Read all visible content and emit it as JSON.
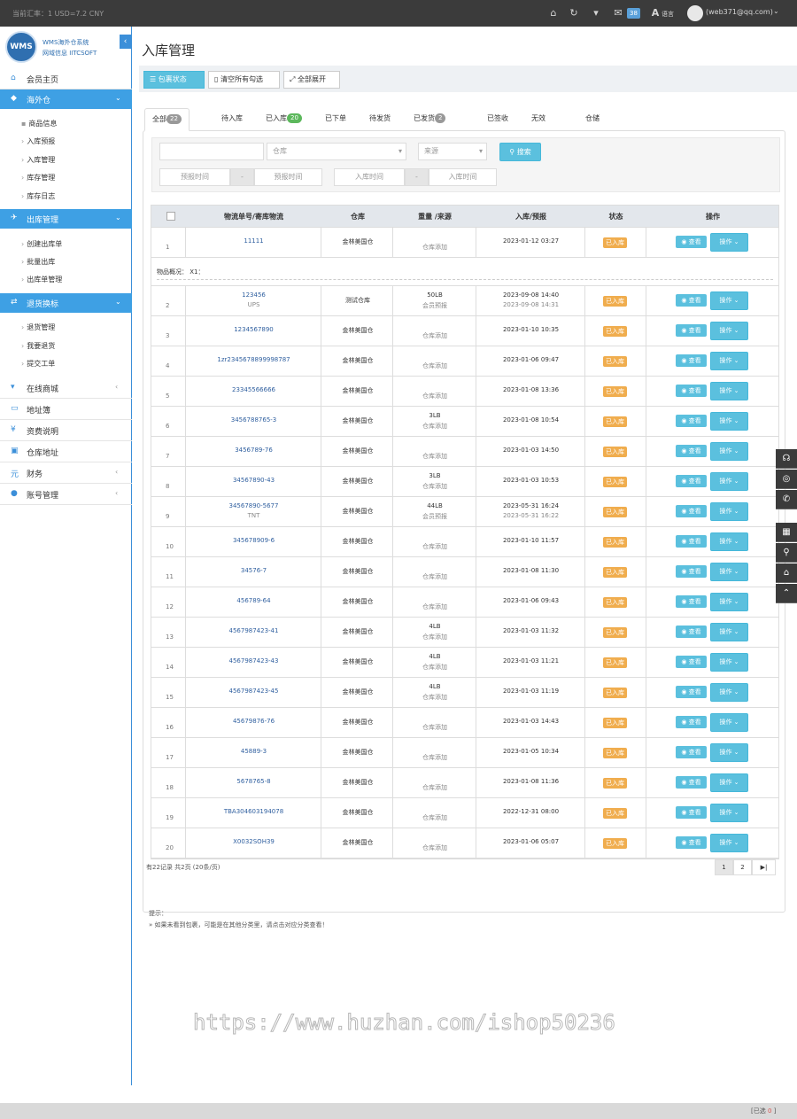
{
  "topbar": {
    "rate": "当前汇率：1 USD=7.2 CNY",
    "icons": [
      "home-icon",
      "refresh-icon",
      "cart-icon",
      "mail-icon"
    ],
    "mail_count": "38",
    "lang": "语言",
    "user": "(web371@qq.com)"
  },
  "brand": {
    "logo": "WMS",
    "line1": "WMS海外仓系统",
    "line2": "网域信息 IITCSOFT"
  },
  "sidebar": {
    "member_home": "会员主页",
    "sec_overseas": "海外仓",
    "overseas_items": [
      "商品信息",
      "入库预报",
      "入库管理",
      "库存管理",
      "库存日志"
    ],
    "sec_outbound": "出库管理",
    "outbound_items": [
      "创建出库单",
      "批量出库",
      "出库单管理"
    ],
    "sec_returns": "退货换标",
    "returns_items": [
      "退货管理",
      "我要退货",
      "提交工单"
    ],
    "online_mall": "在线商城",
    "address_book": "地址簿",
    "fee_desc": "资费说明",
    "warehouse_addr": "仓库地址",
    "finance": "财务",
    "account": "账号管理"
  },
  "page": {
    "title": "入库管理",
    "btn_status": "包裹状态",
    "btn_clear": "清空所有勾选",
    "btn_expand": "全部展开"
  },
  "tabs": {
    "all": "全部",
    "all_count": "22",
    "pending_in": "待入库",
    "in_stock": "已入库",
    "in_stock_count": "20",
    "ordered": "已下单",
    "pending_ship": "待发货",
    "shipped": "已发货",
    "shipped_count": "2",
    "signed": "已签收",
    "invalid": "无效",
    "storage": "仓储"
  },
  "filter": {
    "warehouse_placeholder": "仓库",
    "source_placeholder": "来源",
    "search": "搜索",
    "forecast_from": "预报时间",
    "forecast_to": "预报时间",
    "in_from": "入库时间",
    "in_to": "入库时间",
    "sep": "-"
  },
  "table": {
    "headers": [
      "物流单号/寄库物流",
      "仓库",
      "重量 /来源",
      "入库/预报",
      "状态",
      "操作"
    ],
    "goods_label": "物品概况：  X1：",
    "status_label": "已入库",
    "view_label": "查看",
    "op_label": "操作",
    "rows": [
      {
        "no": "1",
        "trk": "11111",
        "trk2": "",
        "wh": "金林美国仓",
        "w": "",
        "src": "仓库添加",
        "d1": "2023-01-12 03:27",
        "d2": ""
      },
      {
        "no": "2",
        "trk": "123456",
        "trk2": "UPS",
        "wh": "测试仓库",
        "w": "50LB",
        "src": "会员预报",
        "d1": "2023-09-08 14:40",
        "d2": "2023-09-08 14:31"
      },
      {
        "no": "3",
        "trk": "1234567890",
        "trk2": "",
        "wh": "金林美国仓",
        "w": "",
        "src": "仓库添加",
        "d1": "2023-01-10 10:35",
        "d2": ""
      },
      {
        "no": "4",
        "trk": "1zr2345678899998787",
        "trk2": "",
        "wh": "金林美国仓",
        "w": "",
        "src": "仓库添加",
        "d1": "2023-01-06 09:47",
        "d2": ""
      },
      {
        "no": "5",
        "trk": "23345566666",
        "trk2": "",
        "wh": "金林美国仓",
        "w": "",
        "src": "仓库添加",
        "d1": "2023-01-08 13:36",
        "d2": ""
      },
      {
        "no": "6",
        "trk": "3456788765-3",
        "trk2": "",
        "wh": "金林美国仓",
        "w": "3LB",
        "src": "仓库添加",
        "d1": "2023-01-08 10:54",
        "d2": ""
      },
      {
        "no": "7",
        "trk": "3456789-76",
        "trk2": "",
        "wh": "金林美国仓",
        "w": "",
        "src": "仓库添加",
        "d1": "2023-01-03 14:50",
        "d2": ""
      },
      {
        "no": "8",
        "trk": "34567890-43",
        "trk2": "",
        "wh": "金林美国仓",
        "w": "3LB",
        "src": "仓库添加",
        "d1": "2023-01-03 10:53",
        "d2": ""
      },
      {
        "no": "9",
        "trk": "34567890-5677",
        "trk2": "TNT",
        "wh": "金林美国仓",
        "w": "44LB",
        "src": "会员预报",
        "d1": "2023-05-31 16:24",
        "d2": "2023-05-31 16:22"
      },
      {
        "no": "10",
        "trk": "345678909-6",
        "trk2": "",
        "wh": "金林美国仓",
        "w": "",
        "src": "仓库添加",
        "d1": "2023-01-10 11:57",
        "d2": ""
      },
      {
        "no": "11",
        "trk": "34576-7",
        "trk2": "",
        "wh": "金林美国仓",
        "w": "",
        "src": "仓库添加",
        "d1": "2023-01-08 11:30",
        "d2": ""
      },
      {
        "no": "12",
        "trk": "456789-64",
        "trk2": "",
        "wh": "金林美国仓",
        "w": "",
        "src": "仓库添加",
        "d1": "2023-01-06 09:43",
        "d2": ""
      },
      {
        "no": "13",
        "trk": "4567987423-41",
        "trk2": "",
        "wh": "金林美国仓",
        "w": "4LB",
        "src": "仓库添加",
        "d1": "2023-01-03 11:32",
        "d2": ""
      },
      {
        "no": "14",
        "trk": "4567987423-43",
        "trk2": "",
        "wh": "金林美国仓",
        "w": "4LB",
        "src": "仓库添加",
        "d1": "2023-01-03 11:21",
        "d2": ""
      },
      {
        "no": "15",
        "trk": "4567987423-45",
        "trk2": "",
        "wh": "金林美国仓",
        "w": "4LB",
        "src": "仓库添加",
        "d1": "2023-01-03 11:19",
        "d2": ""
      },
      {
        "no": "16",
        "trk": "45679876-76",
        "trk2": "",
        "wh": "金林美国仓",
        "w": "",
        "src": "仓库添加",
        "d1": "2023-01-03 14:43",
        "d2": ""
      },
      {
        "no": "17",
        "trk": "45889-3",
        "trk2": "",
        "wh": "金林美国仓",
        "w": "",
        "src": "仓库添加",
        "d1": "2023-01-05 10:34",
        "d2": ""
      },
      {
        "no": "18",
        "trk": "5678765-8",
        "trk2": "",
        "wh": "金林美国仓",
        "w": "",
        "src": "仓库添加",
        "d1": "2023-01-08 11:36",
        "d2": ""
      },
      {
        "no": "19",
        "trk": "TBA304603194078",
        "trk2": "",
        "wh": "金林美国仓",
        "w": "",
        "src": "仓库添加",
        "d1": "2022-12-31 08:00",
        "d2": ""
      },
      {
        "no": "20",
        "trk": "X0032SOH39",
        "trk2": "",
        "wh": "金林美国仓",
        "w": "",
        "src": "仓库添加",
        "d1": "2023-01-06 05:07",
        "d2": ""
      }
    ]
  },
  "pager": {
    "info": "有22记录 共2页 (20条/页)",
    "p1": "1",
    "p2": "2",
    "last": "▶|"
  },
  "tips": {
    "title": "提示：",
    "line": "» 如果未看到包裹，可能是在其他分类里，请点击对应分类查看！"
  },
  "watermark": "https://www.huzhan.com/ishop50236",
  "bottom": {
    "selected_label": "[已选",
    "selected_count": "0",
    "selected_end": "]"
  }
}
